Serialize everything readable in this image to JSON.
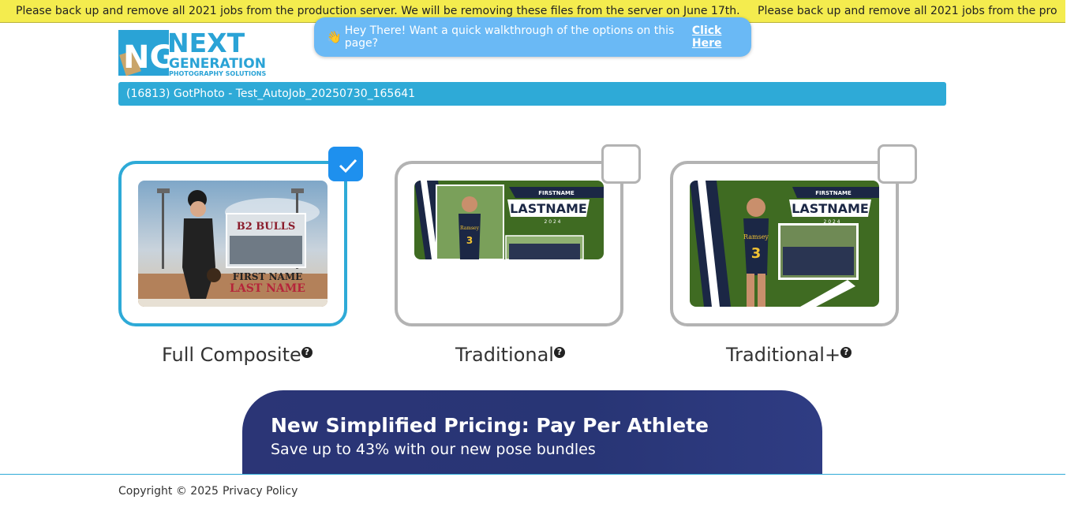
{
  "banner": {
    "message": "Please back up and remove all 2021 jobs from the production server. We will be removing these files from the server on June 17th.",
    "message_repeat": "Please back up and remove all 2021 jobs from the pro"
  },
  "logo": {
    "icon_text": "NG",
    "line1": "NEXT",
    "line2": "GENERATION",
    "line3": "PHOTOGRAPHY SOLUTIONS"
  },
  "walkthrough": {
    "icon": "waving-hand-icon",
    "text": "Hey There! Want a quick walkthrough of the options on this page?",
    "link": "Click Here"
  },
  "job": {
    "title": "(16813) GotPhoto - Test_AutoJob_20250730_165641"
  },
  "options": [
    {
      "label": "Full Composite",
      "selected": true,
      "thumb": {
        "team": "B2 BULLS",
        "first": "FIRST NAME",
        "last": "LAST NAME"
      }
    },
    {
      "label": "Traditional",
      "selected": false,
      "thumb": {
        "first": "FIRSTNAME",
        "last": "LASTNAME",
        "year": "2 0 2 4",
        "jersey": "3",
        "school": "Ramsey"
      }
    },
    {
      "label": "Traditional+",
      "selected": false,
      "thumb": {
        "first": "FIRSTNAME",
        "last": "LASTNAME",
        "year": "2 0 2 4",
        "jersey": "3",
        "school": "Ramsey"
      }
    }
  ],
  "help_glyph": "?",
  "promo": {
    "title": "New Simplified Pricing: Pay Per Athlete",
    "subtitle": "Save up to 43% with our new pose bundles"
  },
  "footer": {
    "copyright": "Copyright © 2025",
    "privacy": "Privacy Policy"
  },
  "colors": {
    "accent": "#2eaad7",
    "checkbox": "#1e90ee",
    "banner": "#f4ec4e",
    "promo": "#2b3576"
  }
}
